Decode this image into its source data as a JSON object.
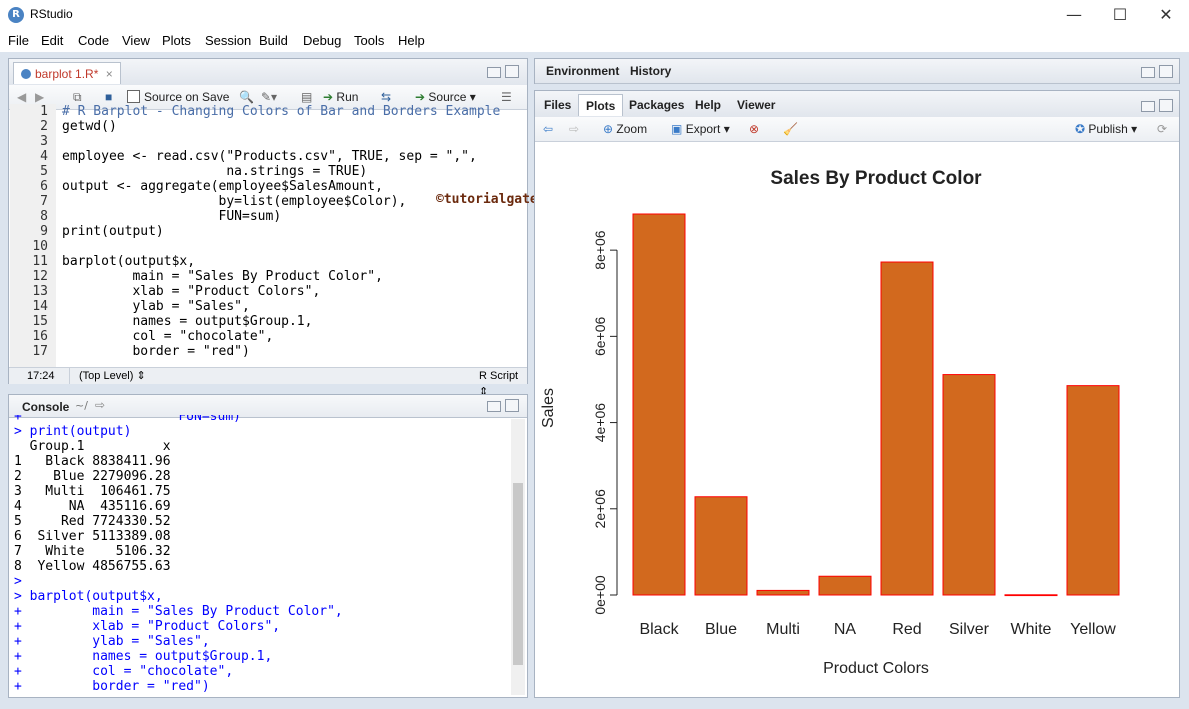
{
  "window": {
    "title": "RStudio",
    "controls": {
      "minimize": "—",
      "maximize": "☐",
      "close": "✕"
    }
  },
  "menu": [
    "File",
    "Edit",
    "Code",
    "View",
    "Plots",
    "Session",
    "Build",
    "Debug",
    "Tools",
    "Help"
  ],
  "source_pane": {
    "tab_label": "barplot 1.R*",
    "toolbar": {
      "source_on_save": "Source on Save",
      "run": "Run",
      "source": "Source"
    },
    "code_lines": [
      {
        "n": "1",
        "text": "# R Barplot - Changing Colors of Bar and Borders Example",
        "kind": "comment"
      },
      {
        "n": "2",
        "text": "getwd()",
        "kind": "code"
      },
      {
        "n": "3",
        "text": "",
        "kind": "code"
      },
      {
        "n": "4",
        "text": "employee <- read.csv(\"Products.csv\", TRUE, sep = \",\",",
        "kind": "code"
      },
      {
        "n": "5",
        "text": "                     na.strings = TRUE)",
        "kind": "code"
      },
      {
        "n": "6",
        "text": "output <- aggregate(employee$SalesAmount,",
        "kind": "code"
      },
      {
        "n": "7",
        "text": "                    by=list(employee$Color),",
        "kind": "code"
      },
      {
        "n": "8",
        "text": "                    FUN=sum)",
        "kind": "code"
      },
      {
        "n": "9",
        "text": "print(output)",
        "kind": "code"
      },
      {
        "n": "10",
        "text": "",
        "kind": "code"
      },
      {
        "n": "11",
        "text": "barplot(output$x,",
        "kind": "code"
      },
      {
        "n": "12",
        "text": "         main = \"Sales By Product Color\",",
        "kind": "code"
      },
      {
        "n": "13",
        "text": "         xlab = \"Product Colors\",",
        "kind": "code"
      },
      {
        "n": "14",
        "text": "         ylab = \"Sales\",",
        "kind": "code"
      },
      {
        "n": "15",
        "text": "         names = output$Group.1,",
        "kind": "code"
      },
      {
        "n": "16",
        "text": "         col = \"chocolate\",",
        "kind": "code"
      },
      {
        "n": "17",
        "text": "         border = \"red\")",
        "kind": "code"
      }
    ],
    "watermark": "©tutorialgateway.org",
    "status": {
      "position": "17:24",
      "scope": "(Top Level)",
      "filetype": "R Script"
    }
  },
  "console_pane": {
    "tab_label": "Console",
    "path": "~/",
    "lines": [
      {
        "text": "+                    FUN=sum)",
        "kind": "cmd"
      },
      {
        "text": "> print(output)",
        "kind": "cmd"
      },
      {
        "text": "  Group.1          x",
        "kind": "out"
      },
      {
        "text": "1   Black 8838411.96",
        "kind": "out"
      },
      {
        "text": "2    Blue 2279096.28",
        "kind": "out"
      },
      {
        "text": "3   Multi  106461.75",
        "kind": "out"
      },
      {
        "text": "4      NA  435116.69",
        "kind": "out"
      },
      {
        "text": "5     Red 7724330.52",
        "kind": "out"
      },
      {
        "text": "6  Silver 5113389.08",
        "kind": "out"
      },
      {
        "text": "7   White    5106.32",
        "kind": "out"
      },
      {
        "text": "8  Yellow 4856755.63",
        "kind": "out"
      },
      {
        "text": ">",
        "kind": "cmd"
      },
      {
        "text": "> barplot(output$x,",
        "kind": "cmd"
      },
      {
        "text": "+         main = \"Sales By Product Color\",",
        "kind": "cmd"
      },
      {
        "text": "+         xlab = \"Product Colors\",",
        "kind": "cmd"
      },
      {
        "text": "+         ylab = \"Sales\",",
        "kind": "cmd"
      },
      {
        "text": "+         names = output$Group.1,",
        "kind": "cmd"
      },
      {
        "text": "+         col = \"chocolate\",",
        "kind": "cmd"
      },
      {
        "text": "+         border = \"red\")",
        "kind": "cmd"
      }
    ]
  },
  "env_pane": {
    "tabs": [
      "Environment",
      "History"
    ]
  },
  "files_pane": {
    "tabs": [
      "Files",
      "Plots",
      "Packages",
      "Help",
      "Viewer"
    ],
    "active_tab": "Plots",
    "toolbar": {
      "zoom": "Zoom",
      "export": "Export",
      "publish": "Publish"
    }
  },
  "colors": {
    "bar_fill": "#d2691e",
    "bar_border": "#ff0000",
    "comment": "#4a6ea8",
    "console_cmd": "#0000ff"
  },
  "chart_data": {
    "type": "bar",
    "title": "Sales By Product Color",
    "xlabel": "Product Colors",
    "ylabel": "Sales",
    "categories": [
      "Black",
      "Blue",
      "Multi",
      "NA",
      "Red",
      "Silver",
      "White",
      "Yellow"
    ],
    "values": [
      8838411.96,
      2279096.28,
      106461.75,
      435116.69,
      7724330.52,
      5113389.08,
      5106.32,
      4856755.63
    ],
    "ylim": [
      0,
      8838411.96
    ],
    "yticks": [
      0,
      2000000,
      4000000,
      6000000,
      8000000
    ],
    "ytick_labels": [
      "0e+00",
      "2e+06",
      "4e+06",
      "6e+06",
      "8e+06"
    ],
    "grid": false,
    "legend": "none"
  }
}
